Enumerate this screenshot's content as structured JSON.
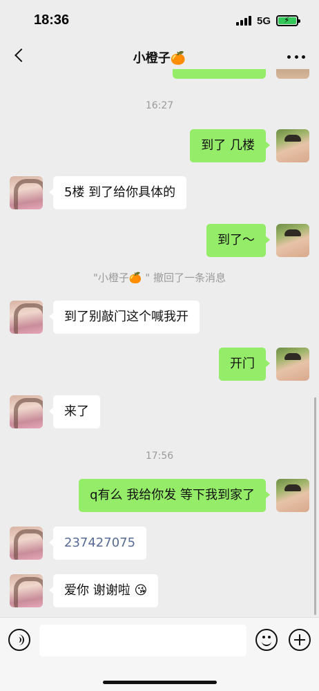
{
  "status_bar": {
    "time": "18:36",
    "network": "5G"
  },
  "nav": {
    "title": "小橙子🍊"
  },
  "timestamps": [
    "16:27",
    "17:56"
  ],
  "system_notice": "\"小橙子🍊 \" 撤回了一条消息",
  "messages": [
    {
      "sender": "me",
      "text": "到了 几楼"
    },
    {
      "sender": "her",
      "text": "5楼 到了给你具体的"
    },
    {
      "sender": "me",
      "text": "到了～"
    },
    {
      "sender": "her",
      "text": "到了别敲门这个喊我开"
    },
    {
      "sender": "me",
      "text": "开门"
    },
    {
      "sender": "her",
      "text": "来了"
    },
    {
      "sender": "me",
      "text": "q有么 我给你发 等下我到家了"
    },
    {
      "sender": "her",
      "text": "237427075"
    },
    {
      "sender": "her",
      "text": "爱你 谢谢啦 😘"
    }
  ],
  "input": {
    "value": "",
    "placeholder": ""
  },
  "colors": {
    "background": "#ededed",
    "my_bubble": "#95ec69",
    "her_bubble": "#ffffff",
    "link": "#576b95"
  }
}
